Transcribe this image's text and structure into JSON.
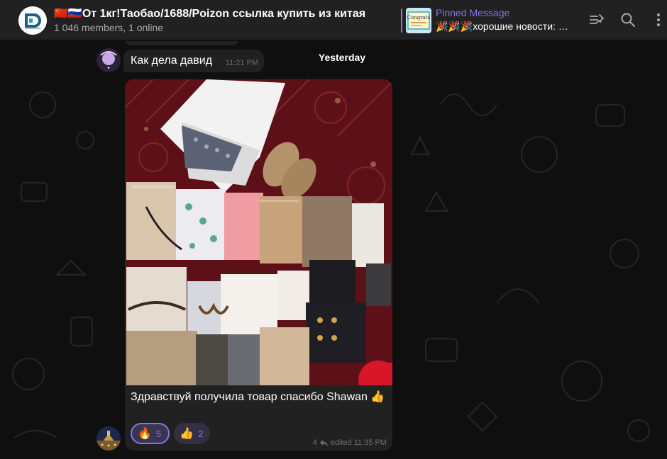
{
  "header": {
    "title": "🇨🇳🇷🇺От 1кг!Таобао/1688/Poizon ссылка купить из китая",
    "subtitle": "1 046 members, 1 online",
    "pinned_label": "Pinned Message",
    "pinned_text": "🎉🎉🎉хорошие новости: Р…",
    "pinned_thumb_text": "Congrats"
  },
  "messages": {
    "greeting": {
      "text": "Как дела давид",
      "time": "11:21 PM"
    },
    "date_separator": "Yesterday",
    "photo_message": {
      "caption": "Здравствуй получила  товар спасибо Shawan 👍",
      "reactions": [
        {
          "emoji": "🔥",
          "count": "5"
        },
        {
          "emoji": "👍",
          "count": "2"
        }
      ],
      "replies": "4",
      "edited_time": "edited 11:35 PM"
    }
  },
  "icons": [
    "unpin-list-icon",
    "search-icon",
    "more-vertical-icon",
    "reply-arrow-icon"
  ],
  "colors": {
    "accent": "#8774e1",
    "bubble": "#212121",
    "header": "#212121",
    "background": "#0f0f0f"
  }
}
